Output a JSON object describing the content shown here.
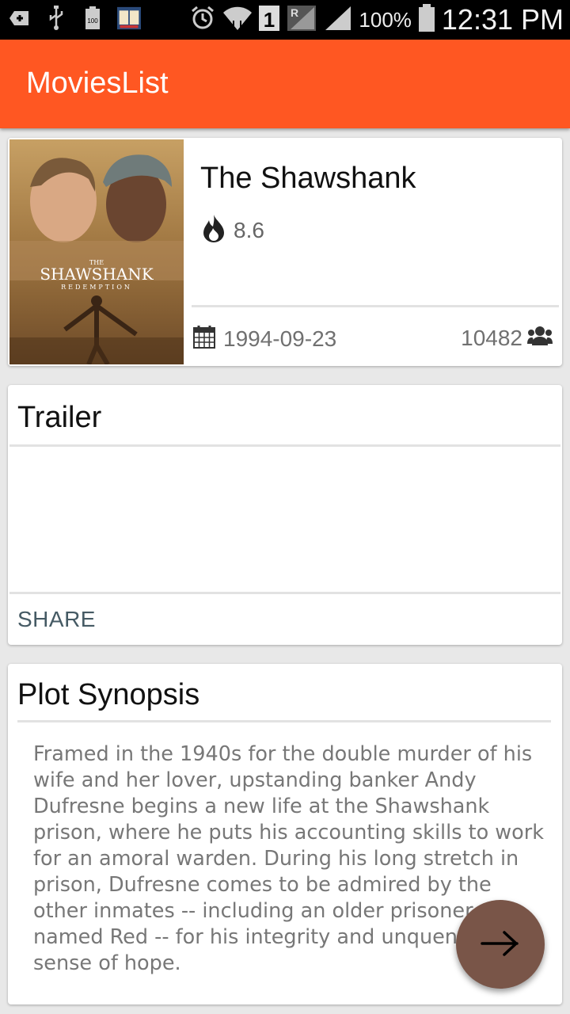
{
  "status_bar": {
    "battery_percent": "100%",
    "time": "12:31 PM",
    "sim_slot": "1",
    "icons": [
      "usb-icon",
      "battery-100-icon",
      "book-app-icon",
      "alarm-icon",
      "wifi-icon",
      "sim-signal-icon",
      "roaming-signal-icon",
      "battery-icon"
    ]
  },
  "app_bar": {
    "title": "MoviesList"
  },
  "movie": {
    "title": "The Shawshank",
    "rating": "8.6",
    "release_date": "1994-09-23",
    "vote_count": "10482",
    "poster": {
      "title_text": "SHAWSHANK",
      "subtitle_text": "REDEMPTION",
      "prefix_text": "THE"
    }
  },
  "trailer": {
    "heading": "Trailer",
    "share_label": "SHARE"
  },
  "plot": {
    "heading": "Plot Synopsis",
    "text": "Framed in the 1940s for the double murder of his wife and her lover, upstanding banker Andy Dufresne begins a new life at the Shawshank prison, where he puts his accounting skills to work for an amoral warden. During his long stretch in prison, Dufresne comes to be admired by the other inmates -- including an older prisoner named Red -- for his integrity and unquenchable sense of hope."
  },
  "fab": {
    "icon": "arrow-right-icon"
  },
  "colors": {
    "primary": "#ff5722",
    "fab": "#795548",
    "share_text": "#455a64"
  }
}
